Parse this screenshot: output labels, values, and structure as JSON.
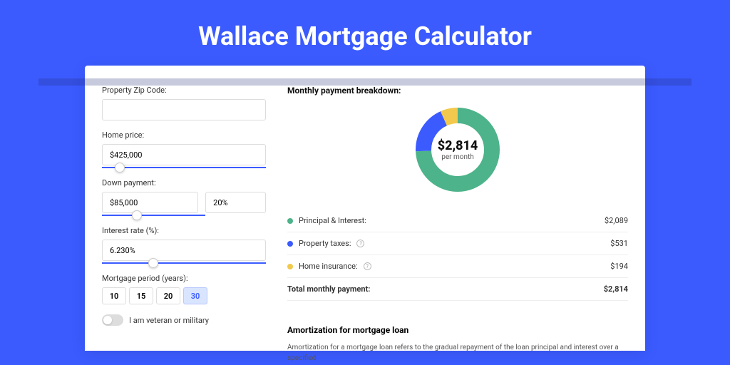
{
  "title": "Wallace Mortgage Calculator",
  "form": {
    "zip": {
      "label": "Property Zip Code:",
      "value": ""
    },
    "price": {
      "label": "Home price:",
      "value": "$425,000"
    },
    "down": {
      "label": "Down payment:",
      "amount": "$85,000",
      "percent": "20%"
    },
    "rate": {
      "label": "Interest rate (%):",
      "value": "6.230%"
    },
    "period": {
      "label": "Mortgage period (years):",
      "options": [
        "10",
        "15",
        "20",
        "30"
      ],
      "active": "30"
    },
    "veteran": {
      "label": "I am veteran or military"
    }
  },
  "breakdown": {
    "title": "Monthly payment breakdown:",
    "center_amount": "$2,814",
    "center_period": "per month",
    "rows": [
      {
        "label": "Principal & Interest:",
        "value": "$2,089"
      },
      {
        "label": "Property taxes:",
        "value": "$531"
      },
      {
        "label": "Home insurance:",
        "value": "$194"
      }
    ],
    "total": {
      "label": "Total monthly payment:",
      "value": "$2,814"
    }
  },
  "amort": {
    "title": "Amortization for mortgage loan",
    "text": "Amortization for a mortgage loan refers to the gradual repayment of the loan principal and interest over a specified"
  },
  "chart_data": {
    "type": "pie",
    "title": "Monthly payment breakdown",
    "series": [
      {
        "name": "Principal & Interest",
        "value": 2089,
        "color": "#4DB38A"
      },
      {
        "name": "Property taxes",
        "value": 531,
        "color": "#3B5BFF"
      },
      {
        "name": "Home insurance",
        "value": 194,
        "color": "#F2C94C"
      }
    ],
    "total": 2814
  }
}
